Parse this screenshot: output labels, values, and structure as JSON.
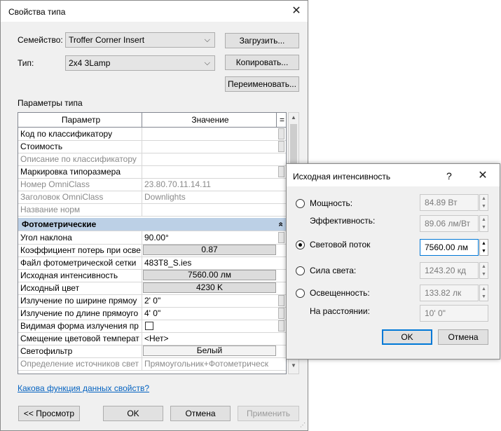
{
  "main_dialog": {
    "title": "Свойства типа",
    "family_label": "Семейство:",
    "family_value": "Troffer Corner Insert",
    "type_label": "Тип:",
    "type_value": "2x4 3Lamp",
    "load_button": "Загрузить...",
    "copy_button": "Копировать...",
    "rename_button": "Переименовать...",
    "type_params_label": "Параметры типа",
    "col_param": "Параметр",
    "col_value": "Значение",
    "col_eq": "=",
    "rows_top": [
      {
        "param": "Код по классификатору",
        "value": "",
        "gray": false
      },
      {
        "param": "Стоимость",
        "value": "",
        "gray": false
      },
      {
        "param": "Описание по классификатору",
        "value": "",
        "gray": true
      },
      {
        "param": "Маркировка типоразмера",
        "value": "",
        "gray": false
      },
      {
        "param": "Номер OmniClass",
        "value": "23.80.70.11.14.11",
        "gray": true
      },
      {
        "param": "Заголовок OmniClass",
        "value": "Downlights",
        "gray": true
      },
      {
        "param": "Название норм",
        "value": "",
        "gray": true
      }
    ],
    "group_label": "Фотометрические",
    "group_collapse": "»",
    "rows_photo": {
      "tilt": {
        "param": "Угол наклона",
        "value": "90.00°"
      },
      "loss": {
        "param": "Коэффициент потерь при осве",
        "value": "0.87"
      },
      "file": {
        "param": "Файл фотометрической сетки",
        "value": "483T8_S.ies"
      },
      "intensity": {
        "param": "Исходная интенсивность",
        "value": "7560.00 лм"
      },
      "color": {
        "param": "Исходный цвет",
        "value": "4230 K"
      },
      "width": {
        "param": "Излучение по ширине прямоу",
        "value": "2'  0\""
      },
      "length": {
        "param": "Излучение по длине прямоуго",
        "value": "4'  0\""
      },
      "visible": {
        "param": "Видимая форма излучения пр",
        "value": ""
      },
      "shift": {
        "param": "Смещение цветовой температ",
        "value": "<Нет>"
      },
      "filter": {
        "param": "Светофильтр",
        "value": "Белый"
      },
      "source": {
        "param": "Определение источников свет",
        "value": "Прямоугольник+Фотометрическ"
      }
    },
    "help_link": "Какова функция данных свойств?",
    "preview_button": "<< Просмотр",
    "ok_button": "OK",
    "cancel_button": "Отмена",
    "apply_button": "Применить"
  },
  "intensity_dialog": {
    "title": "Исходная интенсивность",
    "help": "?",
    "power_label": "Мощность:",
    "power_value": "84.89 Вт",
    "efficacy_label": "Эффективность:",
    "efficacy_value": "89.06 лм/Вт",
    "flux_label": "Световой поток",
    "flux_value": "7560.00 лм",
    "luminous_label": "Сила света:",
    "luminous_value": "1243.20 кд",
    "illum_label": "Освещенность:",
    "illum_value": "133.82 лк",
    "distance_label": "На расстоянии:",
    "distance_value": "10'  0\"",
    "ok_button": "OK",
    "cancel_button": "Отмена",
    "selected": "flux"
  }
}
